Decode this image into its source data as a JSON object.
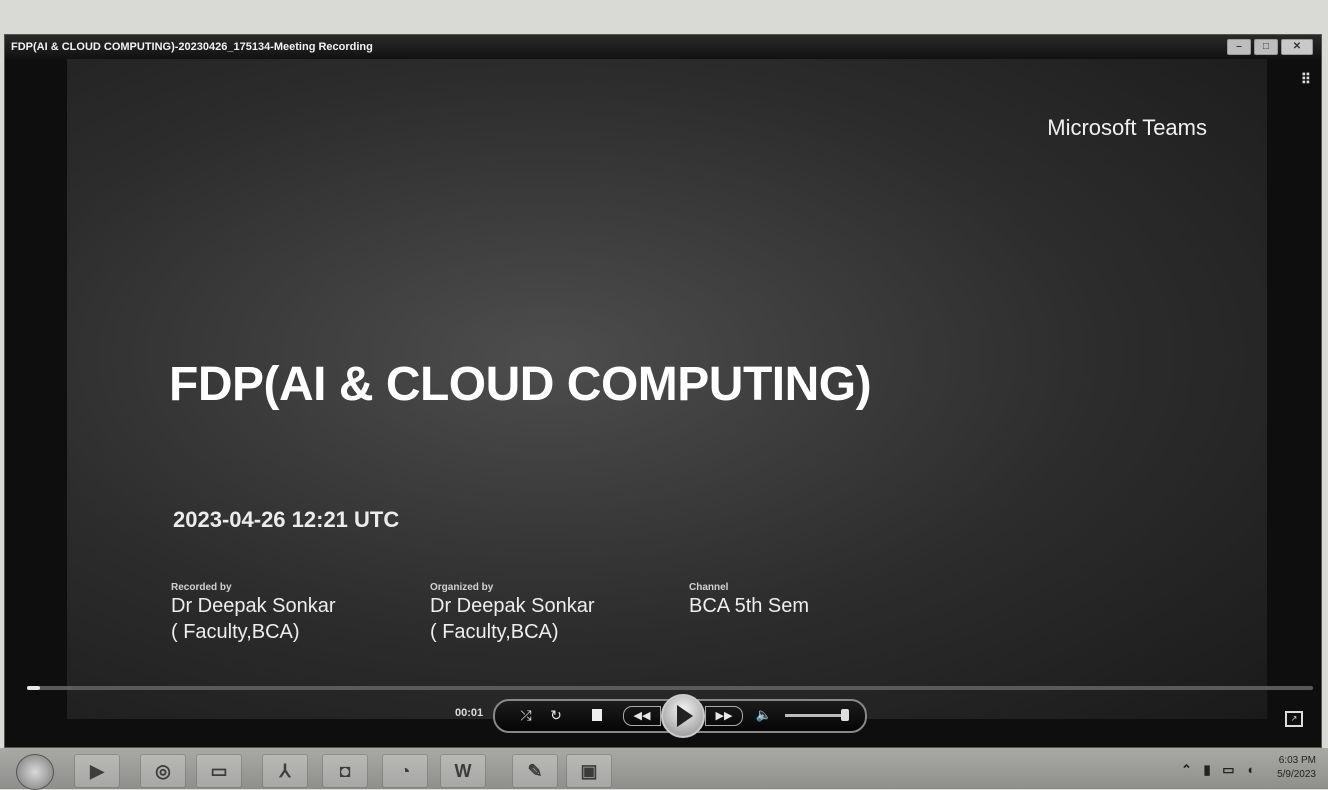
{
  "window": {
    "title": "FDP(AI & CLOUD COMPUTING)-20230426_175134-Meeting Recording"
  },
  "video": {
    "brand": "Microsoft Teams",
    "slide_title": "FDP(AI & CLOUD COMPUTING)",
    "date": "2023-04-26 12:21 UTC",
    "recorded_by": {
      "label": "Recorded by",
      "name": "Dr Deepak Sonkar",
      "role": "( Faculty,BCA)"
    },
    "organized_by": {
      "label": "Organized by",
      "name": "Dr Deepak Sonkar",
      "role": "( Faculty,BCA)"
    },
    "channel": {
      "label": "Channel",
      "name": "BCA 5th Sem"
    }
  },
  "player": {
    "current_time": "00:01",
    "progress": 0.01,
    "controls": [
      "shuffle-icon",
      "repeat-icon",
      "stop-icon",
      "previous-icon",
      "play-icon",
      "next-icon",
      "volume-icon"
    ]
  },
  "taskbar": {
    "items": [
      "start-orb",
      "media-player-icon",
      "chrome-icon",
      "folder-icon",
      "acrobat-icon",
      "camera-icon",
      "media-center-icon",
      "word-icon",
      "paint-icon",
      "photo-editor-icon"
    ],
    "word_label": "W",
    "clock_time": "6:03 PM",
    "clock_date": "5/9/2023"
  },
  "colors": {
    "title_text": "#ffffff",
    "window_bg": "#0e0e0e",
    "taskbar_bg": "#9c9d9a"
  }
}
